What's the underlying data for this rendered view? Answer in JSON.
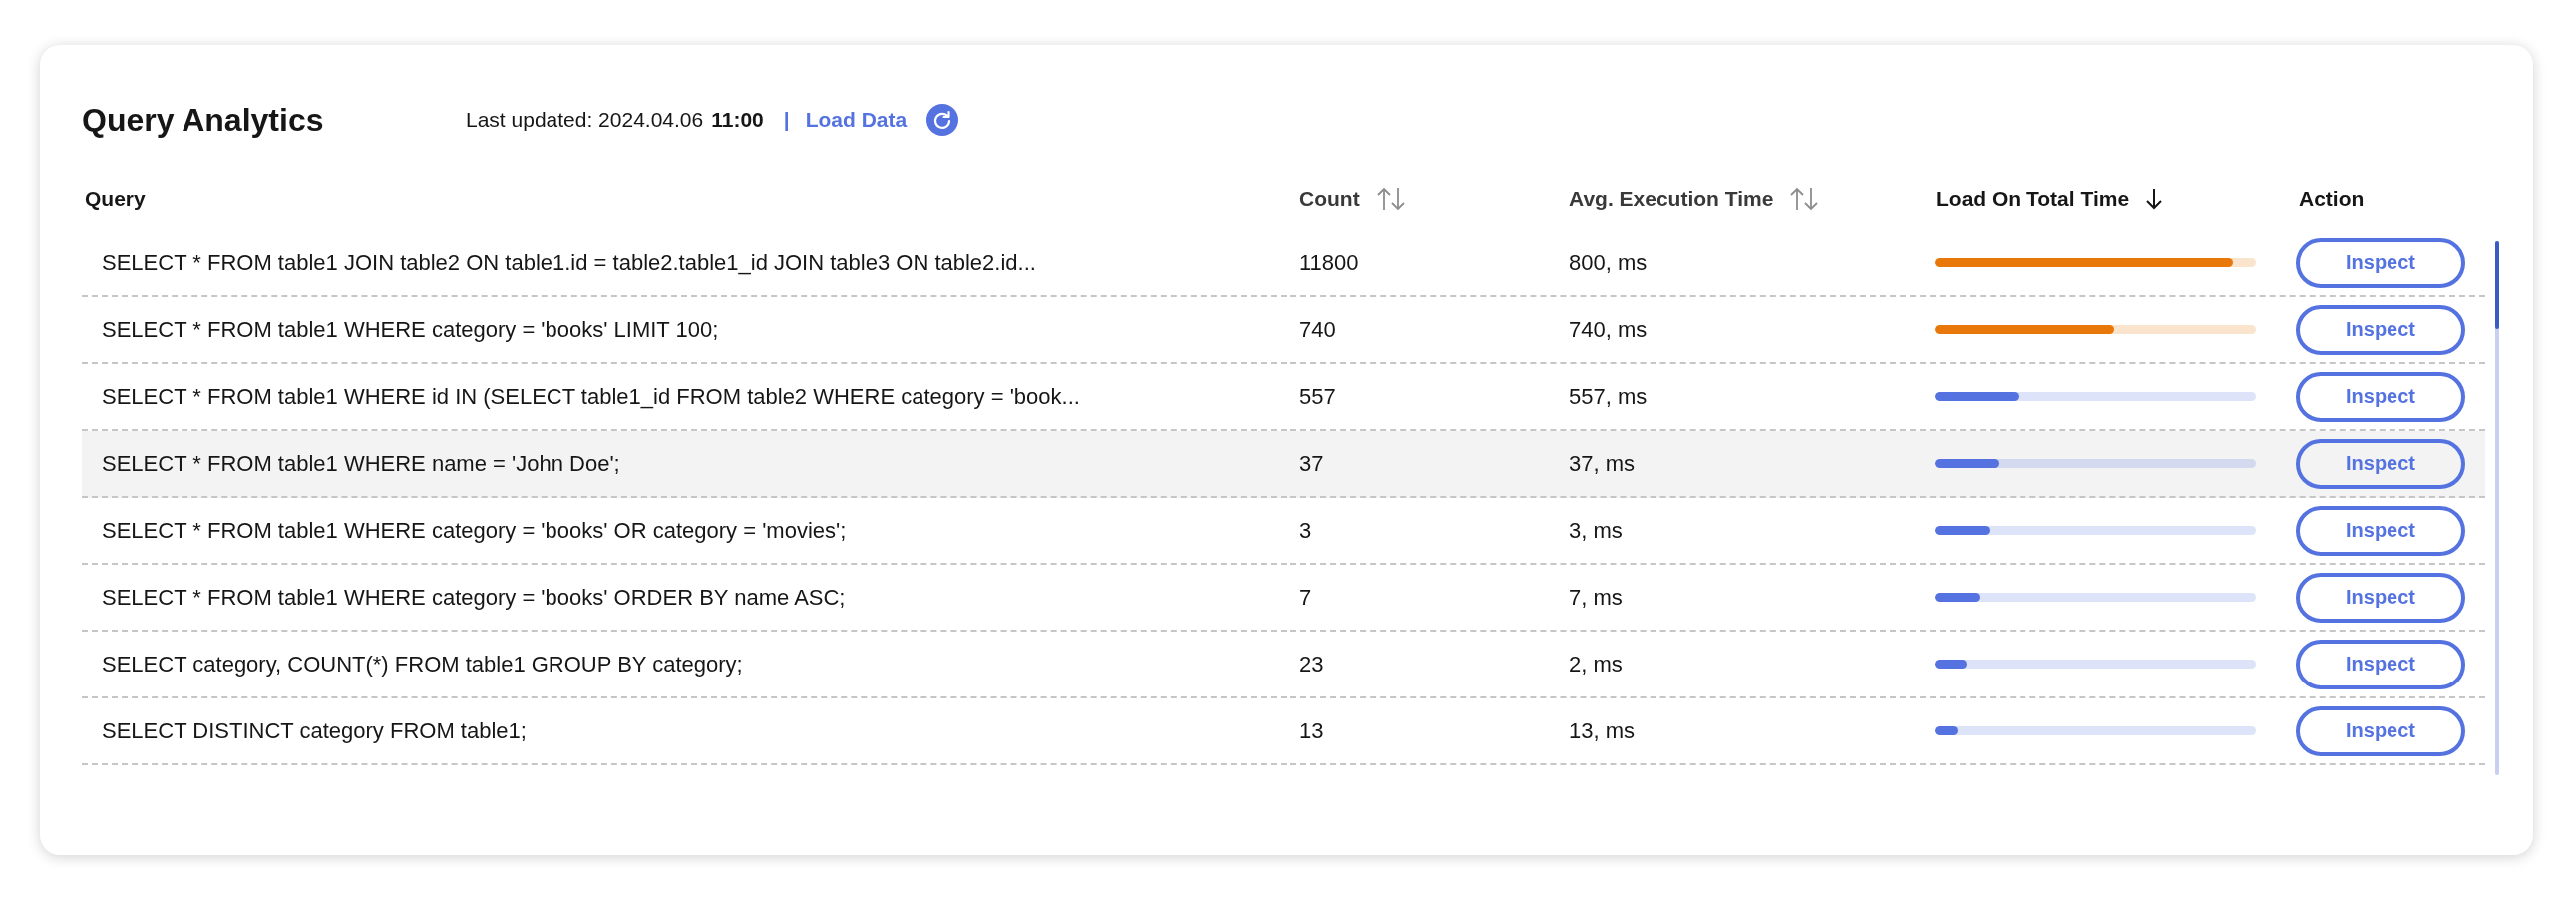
{
  "title": "Query Analytics",
  "last_updated": {
    "label": "Last updated: 2024.04.06",
    "time": "11:00",
    "separator": "|",
    "link": "Load Data"
  },
  "table": {
    "columns": [
      {
        "label": "Query",
        "sortable": false
      },
      {
        "label": "Count",
        "sortable": true,
        "sorted": false
      },
      {
        "label": "Avg. Execution Time",
        "sortable": true,
        "sorted": false
      },
      {
        "label": "Load On Total Time",
        "sortable": true,
        "sorted": true
      },
      {
        "label": "Action",
        "sortable": false
      }
    ],
    "rows": [
      {
        "query": "SELECT * FROM table1 JOIN table2 ON table1.id = table2.table1_id JOIN table3 ON table2.id...",
        "count": "11800",
        "avg": "800, ms",
        "level": 0.93,
        "color": "#e8780a",
        "action": "Inspect",
        "highlighted": false
      },
      {
        "query": "SELECT * FROM table1 WHERE category = 'books' LIMIT 100;",
        "count": "740",
        "avg": "740, ms",
        "level": 0.56,
        "color": "#e8780a",
        "action": "Inspect",
        "highlighted": false
      },
      {
        "query": "SELECT * FROM table1 WHERE id IN (SELECT table1_id FROM table2 WHERE category = 'book...",
        "count": "557",
        "avg": "557, ms",
        "level": 0.26,
        "color": "#5472e0",
        "action": "Inspect",
        "highlighted": false
      },
      {
        "query": "SELECT * FROM table1 WHERE name = 'John Doe';",
        "count": "37",
        "avg": "37, ms",
        "level": 0.2,
        "color": "#5472e0",
        "action": "Inspect",
        "highlighted": true
      },
      {
        "query": "SELECT * FROM table1 WHERE category = 'books' OR category = 'movies';",
        "count": "3",
        "avg": "3, ms",
        "level": 0.17,
        "color": "#5472e0",
        "action": "Inspect",
        "highlighted": false
      },
      {
        "query": "SELECT * FROM table1 WHERE category = 'books' ORDER BY name ASC;",
        "count": "7",
        "avg": "7, ms",
        "level": 0.14,
        "color": "#5472e0",
        "action": "Inspect",
        "highlighted": false
      },
      {
        "query": "SELECT category, COUNT(*) FROM table1 GROUP BY category;",
        "count": "23",
        "avg": "2, ms",
        "level": 0.1,
        "color": "#5472e0",
        "action": "Inspect",
        "highlighted": false
      },
      {
        "query": "SELECT DISTINCT category FROM table1;",
        "count": "13",
        "avg": "13, ms",
        "level": 0.07,
        "color": "#5472e0",
        "action": "Inspect",
        "highlighted": false
      }
    ]
  }
}
